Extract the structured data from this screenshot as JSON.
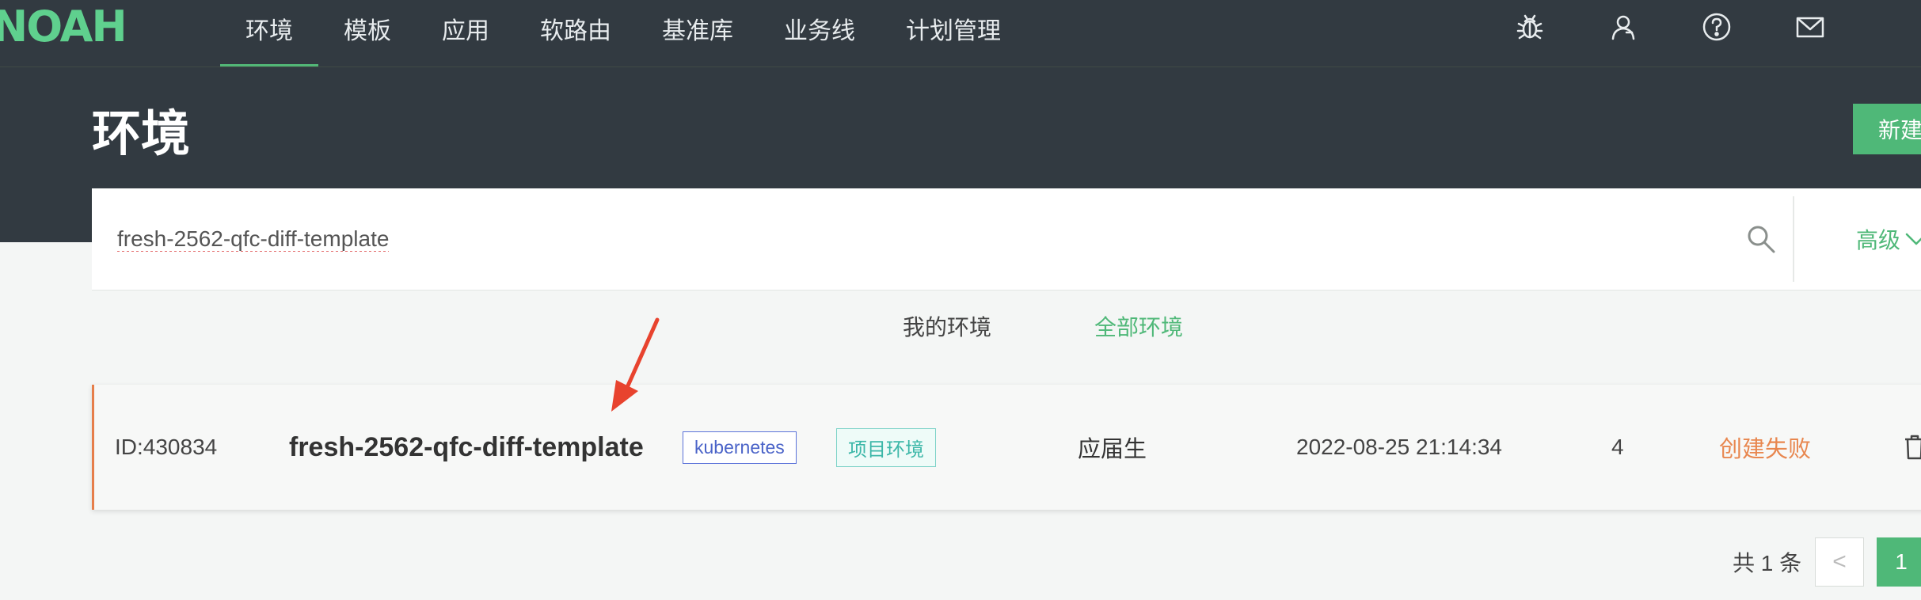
{
  "brand": {
    "logo_text": "NOAH"
  },
  "nav": {
    "items": [
      {
        "label": "环境",
        "active": true
      },
      {
        "label": "模板",
        "active": false
      },
      {
        "label": "应用",
        "active": false
      },
      {
        "label": "软路由",
        "active": false
      },
      {
        "label": "基准库",
        "active": false
      },
      {
        "label": "业务线",
        "active": false
      },
      {
        "label": "计划管理",
        "active": false
      }
    ],
    "icons": [
      "bug-icon",
      "user-icon",
      "help-icon",
      "mail-icon"
    ]
  },
  "page": {
    "title": "环境",
    "new_button": "新建"
  },
  "search": {
    "value": "fresh-2562-qfc-diff-template",
    "advanced_label": "高级"
  },
  "tabs": [
    {
      "label": "我的环境",
      "active": false
    },
    {
      "label": "全部环境",
      "active": true
    }
  ],
  "environments": [
    {
      "id": "ID:430834",
      "name": "fresh-2562-qfc-diff-template",
      "platform_tag": "kubernetes",
      "type_tag": "项目环境",
      "owner": "应届生",
      "created_at": "2022-08-25 21:14:34",
      "count": "4",
      "status": "创建失败"
    }
  ],
  "pagination": {
    "total_label": "共 1 条",
    "prev": "<",
    "current": "1"
  },
  "colors": {
    "accent": "#4fb878",
    "header_bg": "#323a41",
    "status_failed": "#e8874f",
    "annotation_arrow": "#e8432e"
  }
}
